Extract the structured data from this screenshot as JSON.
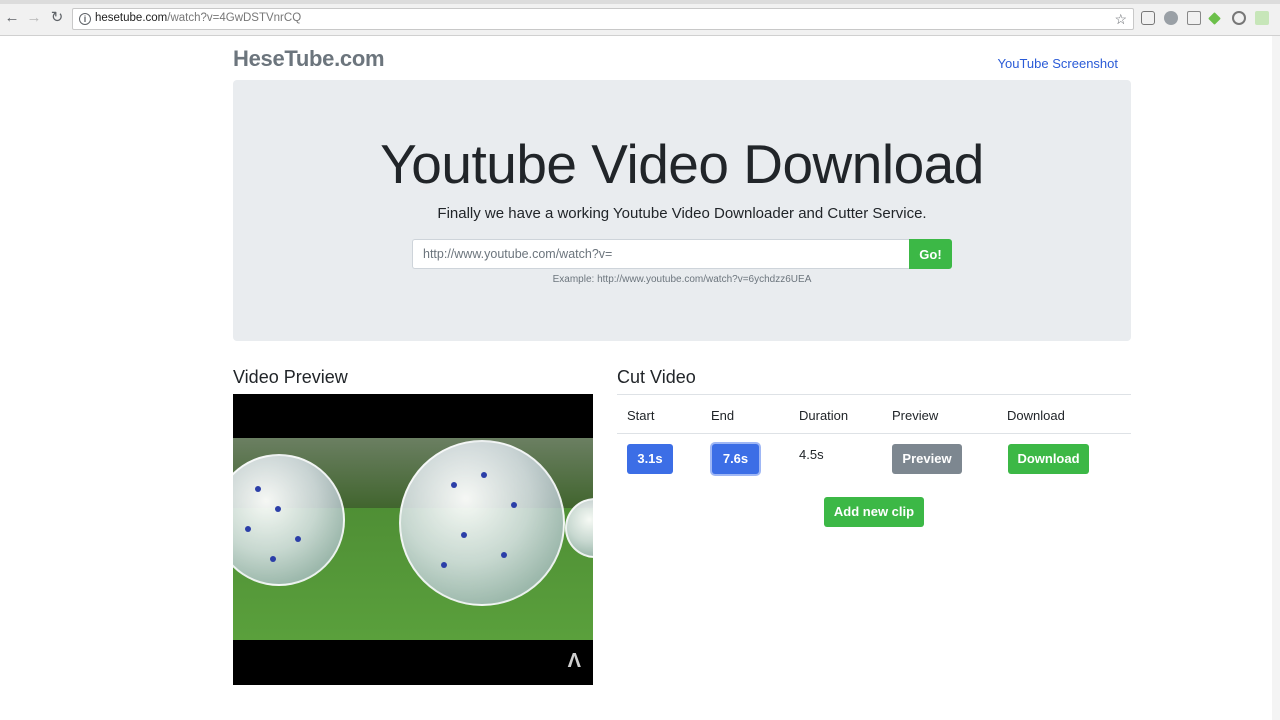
{
  "browser": {
    "url_host": "hesetube.com",
    "url_path": "/watch?v=4GwDSTVnrCQ"
  },
  "header": {
    "brand": "HeseTube.com",
    "link": "YouTube Screenshot"
  },
  "hero": {
    "title": "Youtube Video Download",
    "subtitle": "Finally we have a working Youtube Video Downloader and Cutter Service.",
    "input_placeholder": "http://www.youtube.com/watch?v=",
    "go_label": "Go!",
    "example": "Example: http://www.youtube.com/watch?v=6ychdzz6UEA"
  },
  "preview": {
    "title": "Video Preview"
  },
  "cut": {
    "title": "Cut Video",
    "columns": [
      "Start",
      "End",
      "Duration",
      "Preview",
      "Download"
    ],
    "clip": {
      "start": "3.1s",
      "end": "7.6s",
      "duration": "4.5s",
      "preview_label": "Preview",
      "download_label": "Download"
    },
    "add_label": "Add new clip"
  },
  "colors": {
    "accent_blue": "#3c6ee6",
    "accent_green": "#3cb846",
    "link": "#2a5bd7"
  }
}
